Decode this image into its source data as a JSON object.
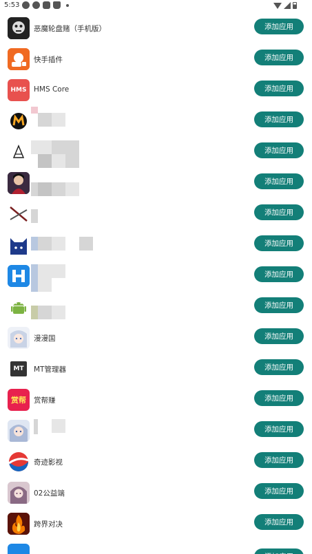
{
  "status_bar": {
    "time": "5:53",
    "notification_icons": [
      "telegram-icon",
      "telegram-icon",
      "message-icon",
      "cat-icon"
    ],
    "right_icons": [
      "wifi-icon",
      "signal-icon",
      "battery-icon"
    ]
  },
  "apps": [
    {
      "name": "恶魔轮盘赌（手机版）",
      "button": "添加应用"
    },
    {
      "name": "快手插件",
      "button": "添加应用"
    },
    {
      "name": "HMS Core",
      "button": "添加应用"
    },
    {
      "name": "",
      "button": "添加应用"
    },
    {
      "name": "",
      "button": "添加应用"
    },
    {
      "name": "",
      "button": "添加应用"
    },
    {
      "name": "",
      "button": "添加应用"
    },
    {
      "name": "",
      "button": "添加应用"
    },
    {
      "name": "",
      "button": "添加应用"
    },
    {
      "name": "",
      "button": "添加应用"
    },
    {
      "name": "漫漫国",
      "button": "添加应用"
    },
    {
      "name": "MT管理器",
      "button": "添加应用"
    },
    {
      "name": "赏帮赚",
      "button": "添加应用"
    },
    {
      "name": "",
      "button": "添加应用"
    },
    {
      "name": "奇迹影视",
      "button": "添加应用"
    },
    {
      "name": "02公益端",
      "button": "添加应用"
    },
    {
      "name": "跨界对决",
      "button": "添加应用"
    },
    {
      "name": "",
      "button": "添加应用"
    }
  ],
  "icon_labels": {
    "hms": "HMS",
    "mt": "MT",
    "shangbang": "赏帮"
  },
  "accent_color": "#137f78"
}
